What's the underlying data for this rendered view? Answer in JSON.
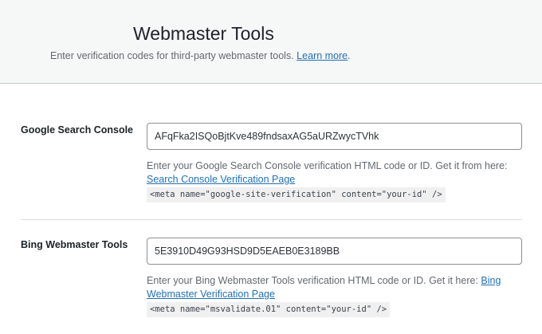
{
  "header": {
    "title": "Webmaster Tools",
    "subtitle": "Enter verification codes for third-party webmaster tools.",
    "learn_more": "Learn more",
    "period": "."
  },
  "fields": [
    {
      "label": "Google Search Console",
      "value": "AFqFka2ISQoBjtKve489fndsaxAG5aURZwycTVhk",
      "desc": "Enter your Google Search Console verification HTML code or ID. Get it from here: ",
      "link": "Search Console Verification Page",
      "code": "<meta name=\"google-site-verification\" content=\"your-id\" />"
    },
    {
      "label": "Bing Webmaster Tools",
      "value": "5E3910D49G93HSD9D5EAEB0E3189BB",
      "desc": "Enter your Bing Webmaster Tools verification HTML code or ID. Get it here: ",
      "link": "Bing Webmaster Verification Page",
      "code": "<meta name=\"msvalidate.01\" content=\"your-id\" />"
    }
  ]
}
